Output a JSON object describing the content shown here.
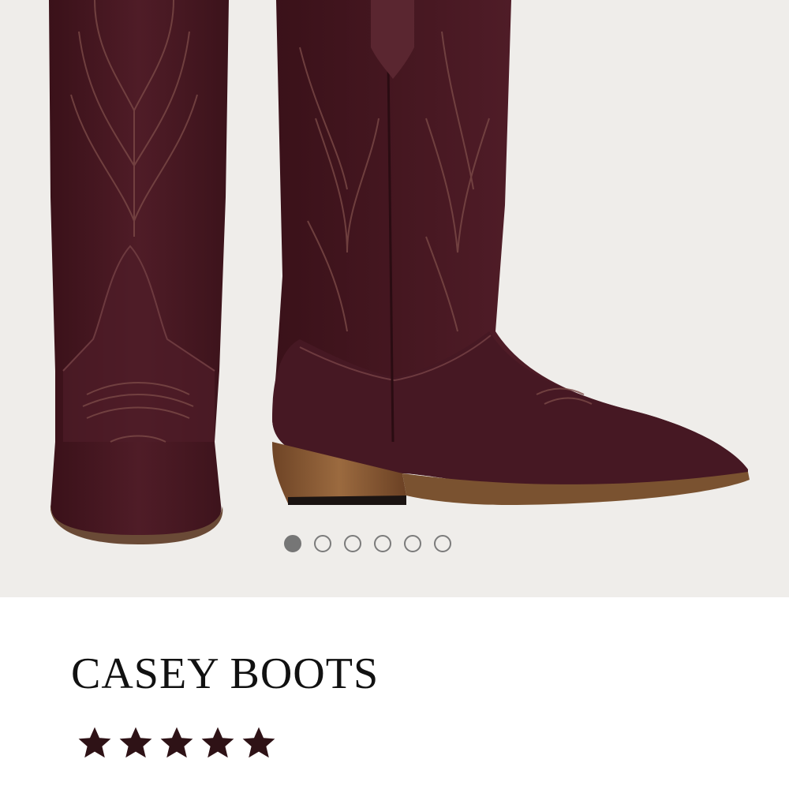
{
  "product": {
    "name": "CASEY BOOTS",
    "rating": 5,
    "rating_max": 5,
    "image_icon": "boot-product-image",
    "colors": {
      "boot": "#4a1a24",
      "boot_dark": "#3a1119",
      "stitch": "#7b4a47",
      "heel": "#8a5a34",
      "background": "#efedea",
      "star": "#2e1216",
      "dot_active": "#767676"
    }
  },
  "gallery": {
    "slide_count": 6,
    "active_slide": 1
  }
}
